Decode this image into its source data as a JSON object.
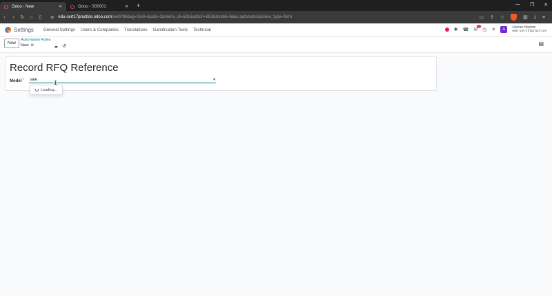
{
  "browser": {
    "tabs": [
      {
        "title": "Odoo - New",
        "active": true
      },
      {
        "title": "Odoo - S00001",
        "active": false
      }
    ],
    "url_host": "edu-cert17practice.odoo.com",
    "url_path": "/web?debug=1#id=&cids=1&menu_id=581&action=853&model=base.automation&view_type=form"
  },
  "app": {
    "name": "Settings",
    "menu": [
      "General Settings",
      "Users & Companies",
      "Translations",
      "Gamification Tools",
      "Technical"
    ],
    "chat_badge": "2",
    "user_initial": "A",
    "user_name": "Usman Hashmi",
    "user_db": "edu-cert17practice"
  },
  "control_panel": {
    "new_label": "New",
    "breadcrumb_parent": "Automation Rules",
    "breadcrumb_current": "New"
  },
  "form": {
    "title": "Record RFQ Reference",
    "model_label": "Model",
    "help_mark": "?",
    "model_value": "sale",
    "dropdown_loading": "Loading..."
  },
  "colors": {
    "accent": "#017e84",
    "brand_purple": "#6d28d9"
  }
}
